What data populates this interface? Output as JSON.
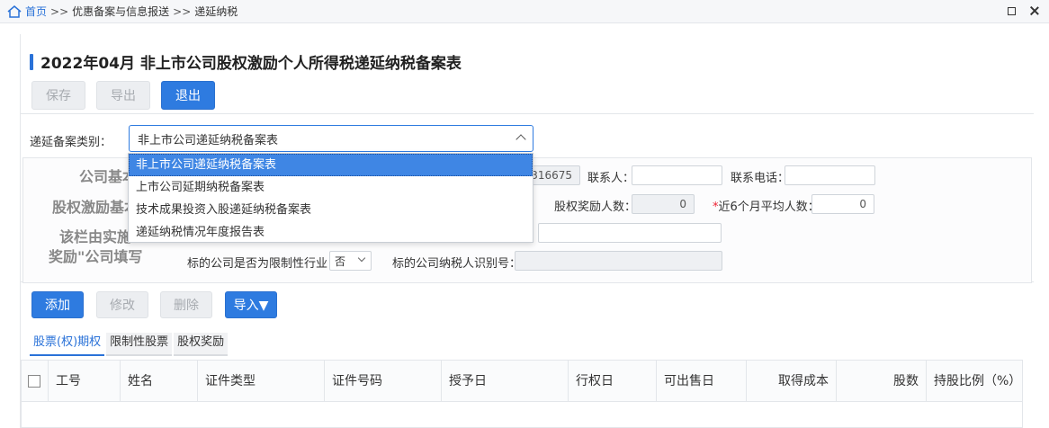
{
  "breadcrumb": {
    "home": "首页",
    "sep": ">>",
    "level1": "优惠备案与信息报送",
    "level2": "递延纳税"
  },
  "title": "2022年04月  非上市公司股权激励个人所得税递延纳税备案表",
  "toolbar": {
    "save": "保存",
    "export": "导出",
    "exit": "退出"
  },
  "form": {
    "category_label": "递延备案类别：",
    "category_value": "非上市公司递延纳税备案表",
    "section1": "公司基本",
    "section2": "股权激励基本",
    "section3_line1": "该栏由实施",
    "section3_line2": "奖励\"公司填写",
    "partial_number": "316675",
    "contact_label": "联系人：",
    "contact_value": "",
    "phone_label": "联系电话：",
    "phone_value": "",
    "reward_count_label": "股权奖励人数：",
    "reward_count_value": "0",
    "avg_count_req": "*",
    "avg_count_label": "近6个月平均人数：",
    "avg_count_value": "0",
    "restricted_label": "标的公司是否为限制性行业",
    "restricted_value": "否",
    "taxid_label": "标的公司纳税人识别号：",
    "taxid_value": ""
  },
  "dropdown_options": [
    "非上市公司递延纳税备案表",
    "上市公司延期纳税备案表",
    "技术成果投资入股递延纳税备案表",
    "递延纳税情况年度报告表"
  ],
  "actions": {
    "add": "添加",
    "edit": "修改",
    "delete": "删除",
    "import": "导入▼"
  },
  "tabs": [
    "股票(权)期权",
    "限制性股票",
    "股权奖励"
  ],
  "table_headers": [
    "工号",
    "姓名",
    "证件类型",
    "证件号码",
    "授予日",
    "行权日",
    "可出售日",
    "取得成本",
    "股数",
    "持股比例（%）"
  ],
  "colors": {
    "accent": "#2e7be0",
    "disabled": "#eceef1",
    "highlight": "#3f86e4"
  }
}
